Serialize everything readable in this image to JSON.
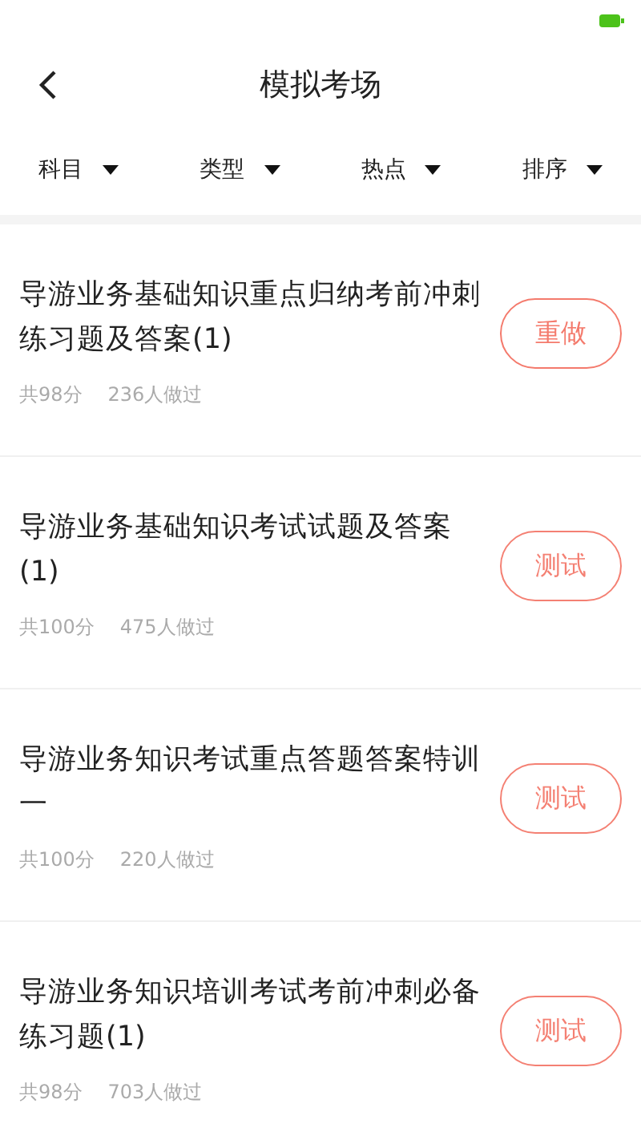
{
  "header": {
    "title": "模拟考场"
  },
  "filters": [
    {
      "label": "科目"
    },
    {
      "label": "类型"
    },
    {
      "label": "热点"
    },
    {
      "label": "排序"
    }
  ],
  "exams": [
    {
      "title": "导游业务基础知识重点归纳考前冲刺练习题及答案(1)",
      "score": "共98分",
      "takers": "236人做过",
      "action": "重做",
      "kind": "redo"
    },
    {
      "title": "导游业务基础知识考试试题及答案(1)",
      "score": "共100分",
      "takers": "475人做过",
      "action": "测试",
      "kind": "test"
    },
    {
      "title": "导游业务知识考试重点答题答案特训一",
      "score": "共100分",
      "takers": "220人做过",
      "action": "测试",
      "kind": "test"
    },
    {
      "title": "导游业务知识培训考试考前冲刺必备练习题(1)",
      "score": "共98分",
      "takers": "703人做过",
      "action": "测试",
      "kind": "test"
    }
  ]
}
